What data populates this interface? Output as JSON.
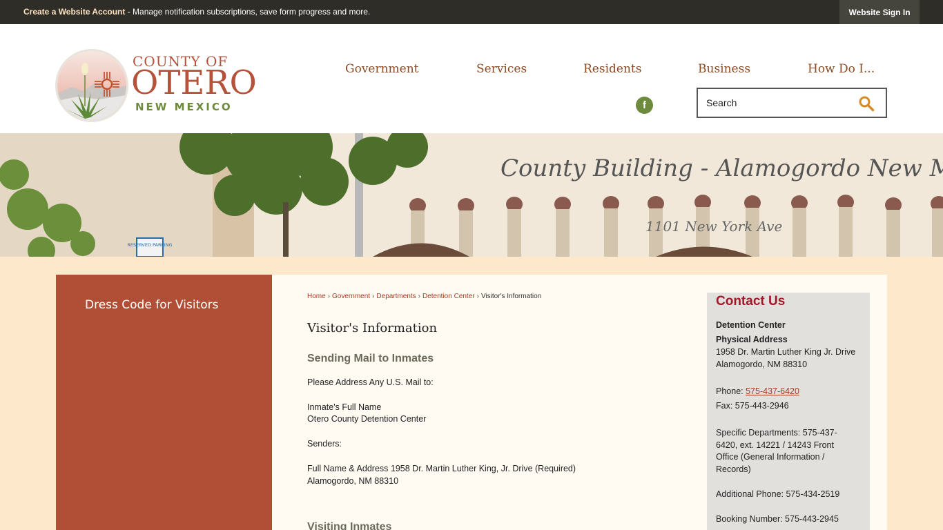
{
  "topbar": {
    "account_link": "Create a Website Account",
    "account_message": " - Manage notification subscriptions, save form progress and more.",
    "signin_label": "Website Sign In"
  },
  "logo": {
    "line1": "COUNTY OF",
    "line2": "OTERO",
    "line3": "NEW MEXICO"
  },
  "nav": {
    "items": [
      {
        "label": "Government"
      },
      {
        "label": "Services"
      },
      {
        "label": "Residents"
      },
      {
        "label": "Business"
      },
      {
        "label": "How Do I..."
      }
    ]
  },
  "social": {
    "facebook_glyph": "f"
  },
  "search": {
    "placeholder": "Search",
    "icon": "search-icon"
  },
  "banner": {
    "sign_text": "County Building - Alamogordo New Mexico",
    "address_text": "1101 New York Ave",
    "parking_sign": "RESERVED PARKING"
  },
  "sidebar": {
    "items": [
      {
        "label": "Dress Code for Visitors"
      }
    ]
  },
  "breadcrumb": {
    "items": [
      "Home",
      "Government",
      "Departments",
      "Detention Center"
    ],
    "current": "Visitor's Information"
  },
  "main": {
    "title": "Visitor's Information",
    "section1_heading": "Sending Mail to Inmates",
    "lines": [
      "Please Address Any U.S. Mail to:",
      "Inmate's Full Name",
      "Otero County Detention Center",
      "Senders:",
      "Full Name & Address 1958 Dr. Martin Luther King, Jr. Drive (Required)",
      "Alamogordo, NM 88310"
    ],
    "section2_heading": "Visiting Inmates"
  },
  "contact": {
    "title": "Contact Us",
    "department": "Detention Center",
    "address_label": "Physical Address",
    "address_line1": "1958 Dr. Martin Luther King Jr. Drive",
    "address_line2": "Alamogordo, NM 88310",
    "phone_label": "Phone: ",
    "phone_value": "575-437-6420",
    "fax": "Fax: 575-443-2946",
    "specific_lines": [
      "Specific Departments: 575-437-",
      "6420, ext. 14221 / 14243 Front",
      "Office (General Information /",
      "Records)"
    ],
    "additional_phone": "Additional Phone: 575-434-2519",
    "booking_number": "Booking Number: 575-443-2945"
  },
  "colors": {
    "brand": "#b5533a",
    "nav_text": "#8a4a23",
    "green": "#6e8b3d",
    "sidebar": "#b14f36",
    "contact_title": "#a0192b"
  }
}
